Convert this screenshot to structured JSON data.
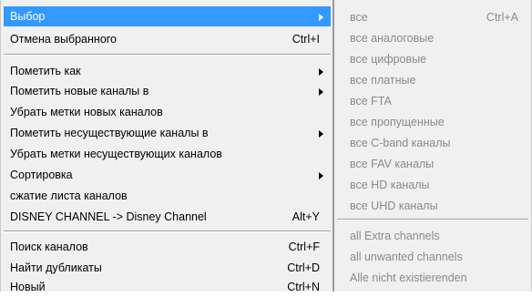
{
  "main_menu": {
    "items": [
      {
        "label": "Выбор",
        "shortcut": "",
        "submenu": true
      },
      {
        "label": "Отмена выбранного",
        "shortcut": "Ctrl+I",
        "submenu": false
      },
      {
        "label": "Пометить как",
        "shortcut": "",
        "submenu": true
      },
      {
        "label": "Пометить новые каналы в",
        "shortcut": "",
        "submenu": true
      },
      {
        "label": "Убрать метки новых каналов",
        "shortcut": "",
        "submenu": false
      },
      {
        "label": "Пометить несуществующие каналы в",
        "shortcut": "",
        "submenu": true
      },
      {
        "label": "Убрать метки несуществующих каналов",
        "shortcut": "",
        "submenu": false
      },
      {
        "label": "Сортировка",
        "shortcut": "",
        "submenu": true
      },
      {
        "label": "сжатие листа каналов",
        "shortcut": "",
        "submenu": false
      },
      {
        "label": "DISNEY CHANNEL -> Disney Channel",
        "shortcut": "Alt+Y",
        "submenu": false
      },
      {
        "label": "Поиск каналов",
        "shortcut": "Ctrl+F",
        "submenu": false
      },
      {
        "label": "Найти дубликаты",
        "shortcut": "Ctrl+D",
        "submenu": false
      },
      {
        "label": "Новый",
        "shortcut": "Ctrl+N",
        "submenu": false
      }
    ]
  },
  "sub_menu": {
    "items": [
      {
        "label": "все",
        "shortcut": "Ctrl+A"
      },
      {
        "label": "все аналоговые",
        "shortcut": ""
      },
      {
        "label": "все цифровые",
        "shortcut": ""
      },
      {
        "label": "все платные",
        "shortcut": ""
      },
      {
        "label": "все FTA",
        "shortcut": ""
      },
      {
        "label": "все пропущенные",
        "shortcut": ""
      },
      {
        "label": "все C-band каналы",
        "shortcut": ""
      },
      {
        "label": "все FAV каналы",
        "shortcut": ""
      },
      {
        "label": "все HD каналы",
        "shortcut": ""
      },
      {
        "label": "все UHD каналы",
        "shortcut": ""
      },
      {
        "label": "all Extra channels",
        "shortcut": ""
      },
      {
        "label": "all unwanted channels",
        "shortcut": ""
      },
      {
        "label": "Alle nicht existierenden",
        "shortcut": ""
      }
    ]
  },
  "colors": {
    "selection": "#3399ff",
    "menu_background": "#f0f0f0",
    "disabled_text": "#8a8a8a"
  }
}
